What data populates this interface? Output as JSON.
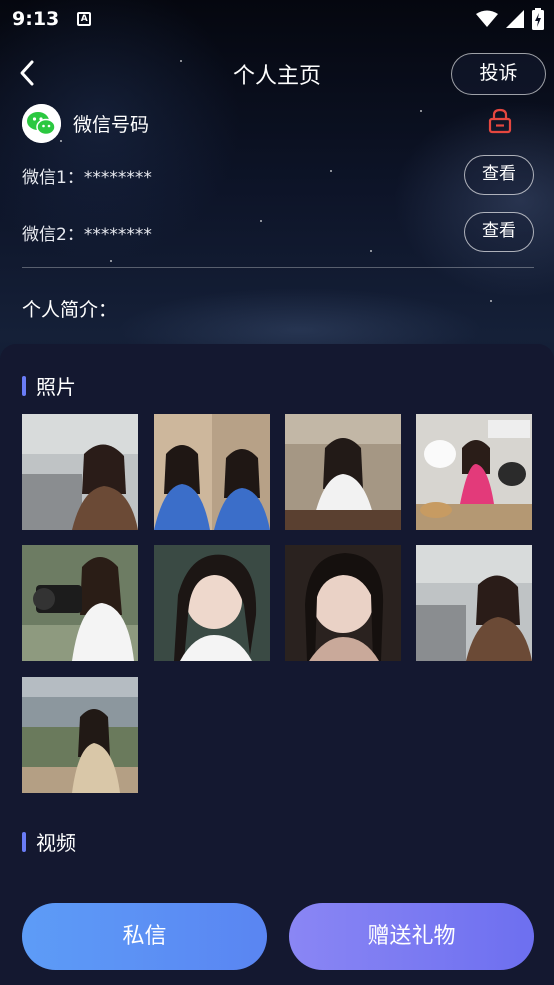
{
  "status_bar": {
    "time": "9:13",
    "notification_icon": "A"
  },
  "nav": {
    "title": "个人主页",
    "report_label": "投诉"
  },
  "contact": {
    "wechat_label": "微信号码",
    "wechat_lines": [
      {
        "text": "微信1：********",
        "button": "查看"
      },
      {
        "text": "微信2：********",
        "button": "查看"
      }
    ],
    "intro_label": "个人简介："
  },
  "sections": {
    "photos_title": "照片",
    "videos_title": "视频"
  },
  "photos": [
    {
      "name": "photo-1"
    },
    {
      "name": "photo-2"
    },
    {
      "name": "photo-3"
    },
    {
      "name": "photo-4"
    },
    {
      "name": "photo-5"
    },
    {
      "name": "photo-6"
    },
    {
      "name": "photo-7"
    },
    {
      "name": "photo-8"
    },
    {
      "name": "photo-9"
    }
  ],
  "actions": {
    "message_label": "私信",
    "gift_label": "赠送礼物"
  },
  "colors": {
    "accent": "#6a7cf6",
    "lock": "#e5473f",
    "wechat_green": "#2bc840",
    "message_button": "#5d9cf7",
    "gift_button": "#7a7af2"
  }
}
